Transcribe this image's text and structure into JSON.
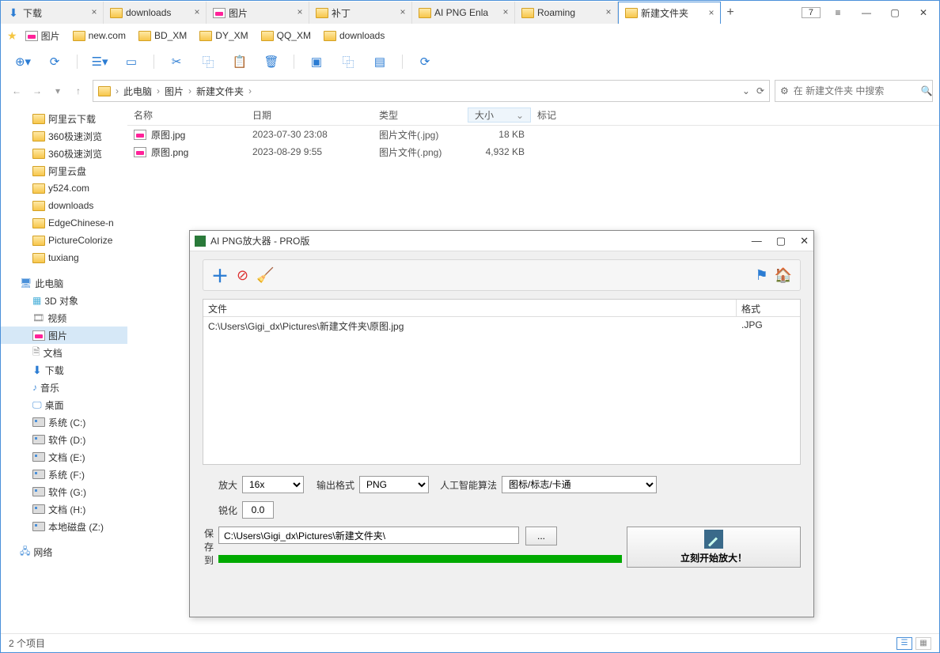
{
  "tabs": [
    {
      "label": "下载",
      "icon": "download"
    },
    {
      "label": "downloads",
      "icon": "folder"
    },
    {
      "label": "图片",
      "icon": "image"
    },
    {
      "label": "补丁",
      "icon": "folder"
    },
    {
      "label": "AI PNG Enla",
      "icon": "folder"
    },
    {
      "label": "Roaming",
      "icon": "folder"
    },
    {
      "label": "新建文件夹",
      "icon": "folder",
      "active": true
    }
  ],
  "tab_count": "7",
  "bookmarks": [
    {
      "label": "图片",
      "icon": "image",
      "starred": true
    },
    {
      "label": "new.com",
      "icon": "folder"
    },
    {
      "label": "BD_XM",
      "icon": "folder"
    },
    {
      "label": "DY_XM",
      "icon": "folder"
    },
    {
      "label": "QQ_XM",
      "icon": "folder"
    },
    {
      "label": "downloads",
      "icon": "folder"
    }
  ],
  "breadcrumb": [
    "此电脑",
    "图片",
    "新建文件夹"
  ],
  "search_placeholder": "在 新建文件夹 中搜索",
  "columns": {
    "name": "名称",
    "date": "日期",
    "type": "类型",
    "size": "大小",
    "tag": "标记"
  },
  "files": [
    {
      "name": "原图.jpg",
      "date": "2023-07-30 23:08",
      "type": "图片文件(.jpg)",
      "size": "18 KB"
    },
    {
      "name": "原图.png",
      "date": "2023-08-29 9:55",
      "type": "图片文件(.png)",
      "size": "4,932 KB"
    }
  ],
  "tree_favorites": [
    "阿里云下载",
    "360极速浏览",
    "360极速浏览",
    "阿里云盘",
    "y524.com",
    "downloads",
    "EdgeChinese-n",
    "PictureColorize",
    "tuxiang"
  ],
  "tree_pc_label": "此电脑",
  "tree_pc": [
    {
      "label": "3D 对象",
      "icon": "3d"
    },
    {
      "label": "视频",
      "icon": "video"
    },
    {
      "label": "图片",
      "icon": "image",
      "selected": true
    },
    {
      "label": "文档",
      "icon": "doc"
    },
    {
      "label": "下载",
      "icon": "download"
    },
    {
      "label": "音乐",
      "icon": "music"
    },
    {
      "label": "桌面",
      "icon": "desktop"
    },
    {
      "label": "系统 (C:)",
      "icon": "drive"
    },
    {
      "label": "软件 (D:)",
      "icon": "drive"
    },
    {
      "label": "文档 (E:)",
      "icon": "drive"
    },
    {
      "label": "系统 (F:)",
      "icon": "drive"
    },
    {
      "label": "软件 (G:)",
      "icon": "drive"
    },
    {
      "label": "文档 (H:)",
      "icon": "drive"
    },
    {
      "label": "本地磁盘 (Z:)",
      "icon": "drive"
    }
  ],
  "tree_network": "网络",
  "status_text": "2 个项目",
  "dialog": {
    "title": "AI PNG放大器 - PRO版",
    "list_header_file": "文件",
    "list_header_fmt": "格式",
    "row_file": "C:\\Users\\Gigi_dx\\Pictures\\新建文件夹\\原图.jpg",
    "row_fmt": ".JPG",
    "label_enlarge": "放大",
    "val_enlarge": "16x",
    "label_outfmt": "输出格式",
    "val_outfmt": "PNG",
    "label_algo": "人工智能算法",
    "val_algo": "图标/标志/卡通",
    "label_sharpen": "锐化",
    "val_sharpen": "0.0",
    "label_saveto": "保存到",
    "val_saveto": "C:\\Users\\Gigi_dx\\Pictures\\新建文件夹\\",
    "browse": "...",
    "go": "立刻开始放大！"
  }
}
